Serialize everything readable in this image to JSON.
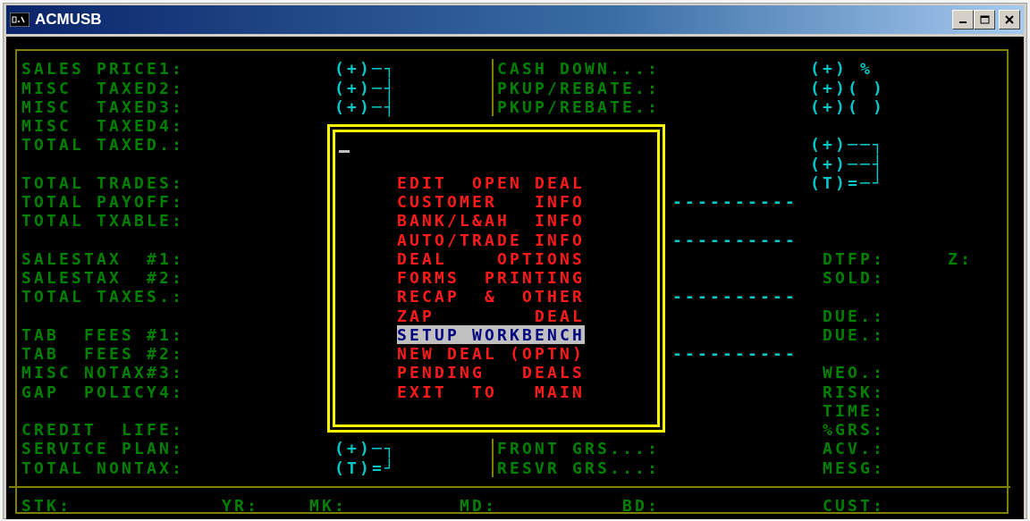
{
  "window": {
    "title": "ACMUSB"
  },
  "left_fields": [
    "SALES PRICE1:",
    "MISC  TAXED2:",
    "MISC  TAXED3:",
    "MISC  TAXED4:",
    "TOTAL TAXED.:",
    "TOTAL TRADES:",
    "TOTAL PAYOFF:",
    "TOTAL TXABLE:",
    "SALESTAX  #1:",
    "SALESTAX  #2:",
    "TOTAL TAXES.:",
    "TAB  FEES #1:",
    "TAB  FEES #2:",
    "MISC NOTAX#3:",
    "GAP  POLICY4:",
    "CREDIT  LIFE:",
    "SERVICE PLAN:",
    "TOTAL NONTAX:"
  ],
  "left_markers": [
    "(+)─┐",
    "(+)─┤",
    "(+)─┤"
  ],
  "left_bottom_markers": [
    "(+)─┐",
    "(T)=┘"
  ],
  "center_fields": [
    "CASH DOWN...:",
    "PKUP/REBATE.:",
    "PKUP/REBATE.:"
  ],
  "center_bottom_fields": [
    "FRONT GRS...:",
    "RESVR GRS...:"
  ],
  "right_markers": [
    "(+) %",
    "(+)( )",
    "(+)( )",
    "(+)──┐",
    "(+)──┤",
    "(T)=─┘"
  ],
  "rules": [
    "----------",
    "----------",
    "----------",
    "----------"
  ],
  "right_fields": [
    "DTFP:",
    "SOLD:",
    "DUE.:",
    "DUE.:",
    "WEO.:",
    "RISK:",
    "TIME:",
    "%GRS:",
    "ACV.:",
    "MESG:"
  ],
  "z_label": "Z:",
  "menu": {
    "items": [
      {
        "label": "EDIT  OPEN DEAL",
        "selected": false
      },
      {
        "label": "CUSTOMER   INFO",
        "selected": false
      },
      {
        "label": "BANK/L&AH  INFO",
        "selected": false
      },
      {
        "label": "AUTO/TRADE INFO",
        "selected": false
      },
      {
        "label": "DEAL    OPTIONS",
        "selected": false
      },
      {
        "label": "FORMS  PRINTING",
        "selected": false
      },
      {
        "label": "RECAP  &  OTHER",
        "selected": false
      },
      {
        "label": "ZAP        DEAL",
        "selected": false
      },
      {
        "label": "SETUP WORKBENCH",
        "selected": true
      },
      {
        "label": "NEW DEAL (OPTN)",
        "selected": false
      },
      {
        "label": "PENDING   DEALS",
        "selected": false
      },
      {
        "label": "EXIT  TO   MAIN",
        "selected": false
      }
    ]
  },
  "bottom_fields": [
    "STK:",
    "YR:",
    "MK:",
    "MD:",
    "BD:",
    "CUST:"
  ]
}
